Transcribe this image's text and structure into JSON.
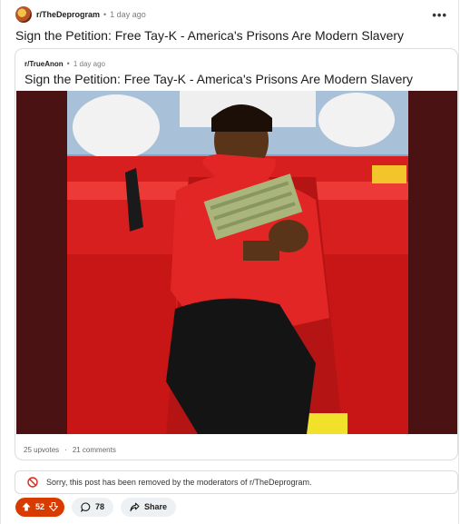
{
  "post": {
    "subreddit": "r/TheDeprogram",
    "separator": "•",
    "age": "1 day ago",
    "more_label": "•••",
    "title": "Sign the Petition: Free Tay-K - America's Prisons Are Modern Slavery"
  },
  "crosspost": {
    "subreddit": "r/TrueAnon",
    "separator": "•",
    "age": "1 day ago",
    "title": "Sign the Petition: Free Tay-K - America's Prisons Are Modern Slavery",
    "upvotes": "25 upvotes",
    "separator2": "·",
    "comments": "21 comments"
  },
  "notice": {
    "text": "Sorry, this post has been removed by the moderators of r/TheDeprogram.",
    "icon": "ban-icon"
  },
  "actions": {
    "score": "52",
    "comments": "78",
    "share_label": "Share"
  },
  "colors": {
    "upvote_bg": "#d93a00",
    "notice_icon": "#e0261b"
  }
}
